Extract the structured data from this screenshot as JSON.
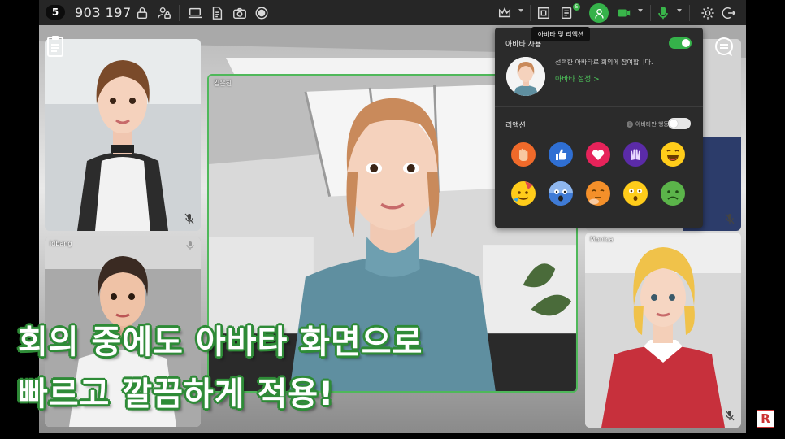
{
  "toolbar": {
    "room_number": "5",
    "meeting_id": "903 197",
    "chat_badge": "5",
    "avatar_tooltip": "아바타 및 리액션"
  },
  "participants": {
    "main": {
      "name": "김은진"
    },
    "top_left": {
      "name": ""
    },
    "bottom_left": {
      "name": "idbang"
    },
    "bottom_right": {
      "name": "Monica"
    }
  },
  "avatar_panel": {
    "title": "아바타 사용",
    "avatar_enabled": true,
    "description": "선택한 아바타로 회의에 참여합니다.",
    "settings_link": "아바타 설정 >",
    "reaction_title": "리액션",
    "avatar_only_label": "아바타만 행동",
    "avatar_only_enabled": false,
    "reactions": [
      "raise-hand",
      "thumbs-up",
      "heart",
      "clap",
      "laugh",
      "party",
      "shocked",
      "thinking",
      "surprised",
      "sick"
    ]
  },
  "caption": {
    "line1": "회의 중에도 아바타 화면으로",
    "line2": "빠르고 깔끔하게 적용!"
  },
  "colors": {
    "accent": "#35b24a",
    "toolbar_bg": "#262626",
    "panel_bg": "#2b2b2b"
  }
}
